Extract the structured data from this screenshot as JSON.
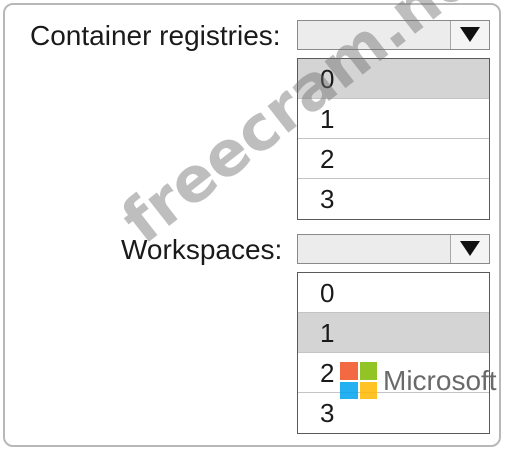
{
  "container_registries": {
    "label": "Container registries:",
    "selected_value": "",
    "options": [
      "0",
      "1",
      "2",
      "3"
    ],
    "highlighted_index": 0
  },
  "workspaces": {
    "label": "Workspaces:",
    "selected_value": "",
    "options": [
      "0",
      "1",
      "2",
      "3"
    ],
    "highlighted_index": 1
  },
  "branding": {
    "ms_text": "Microsoft",
    "ms_colors": [
      "#f25022",
      "#7fba00",
      "#00a4ef",
      "#ffb900"
    ]
  },
  "watermark": {
    "text": "freecram.net"
  },
  "icons": {
    "dropdown": "triangle-down-icon"
  }
}
